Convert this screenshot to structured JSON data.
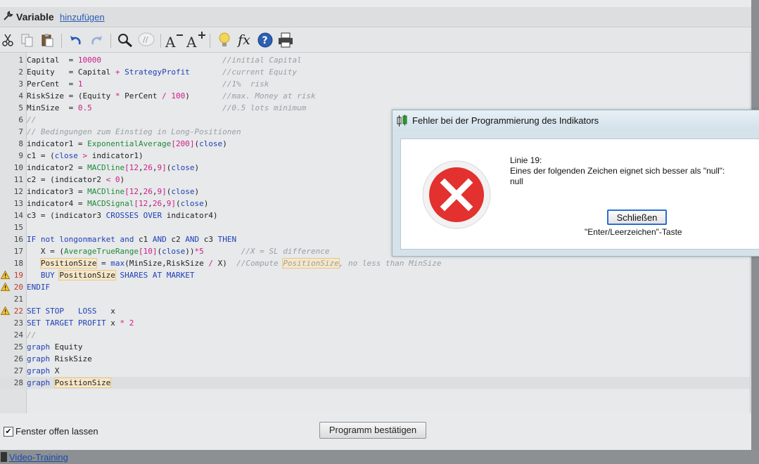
{
  "window": {
    "title": "Variable",
    "add_link": "hinzufügen"
  },
  "toolbar": {
    "icons": [
      "cut-icon",
      "copy-icon",
      "paste-icon",
      "undo-icon",
      "redo-icon",
      "search-icon",
      "comment-icon",
      "font-decrease-icon",
      "font-increase-icon",
      "lightbulb-icon",
      "function-icon",
      "help-icon",
      "print-icon"
    ]
  },
  "editor": {
    "lines": [
      {
        "n": "1",
        "warn": false
      },
      {
        "n": "2",
        "warn": false
      },
      {
        "n": "3",
        "warn": false
      },
      {
        "n": "4",
        "warn": false
      },
      {
        "n": "5",
        "warn": false
      },
      {
        "n": "6",
        "warn": false
      },
      {
        "n": "7",
        "warn": false
      },
      {
        "n": "8",
        "warn": false
      },
      {
        "n": "9",
        "warn": false
      },
      {
        "n": "10",
        "warn": false
      },
      {
        "n": "11",
        "warn": false
      },
      {
        "n": "12",
        "warn": false
      },
      {
        "n": "13",
        "warn": false
      },
      {
        "n": "14",
        "warn": false
      },
      {
        "n": "15",
        "warn": false
      },
      {
        "n": "16",
        "warn": false
      },
      {
        "n": "17",
        "warn": false
      },
      {
        "n": "18",
        "warn": false
      },
      {
        "n": "19",
        "warn": true
      },
      {
        "n": "20",
        "warn": true
      },
      {
        "n": "21",
        "warn": false
      },
      {
        "n": "22",
        "warn": true
      },
      {
        "n": "23",
        "warn": false
      },
      {
        "n": "24",
        "warn": false
      },
      {
        "n": "25",
        "warn": false
      },
      {
        "n": "26",
        "warn": false
      },
      {
        "n": "27",
        "warn": false
      },
      {
        "n": "28",
        "warn": false
      }
    ],
    "code": [
      "Capital  = 10000                          //initial Capital",
      "Equity   = Capital + StrategyProfit       //current Equity",
      "PerCent  = 1                              //1%  risk",
      "RiskSize = (Equity * PerCent / 100)       //max. Money at risk",
      "MinSize  = 0.5                            //0.5 lots minimum",
      "//",
      "// Bedingungen zum Einstieg in Long-Positionen",
      "indicator1 = ExponentialAverage[200](close)",
      "c1 = (close > indicator1)",
      "indicator2 = MACDline[12,26,9](close)",
      "c2 = (indicator2 < 0)",
      "indicator3 = MACDline[12,26,9](close)",
      "indicator4 = MACDSignal[12,26,9](close)",
      "c3 = (indicator3 CROSSES OVER indicator4)",
      "",
      "IF not longonmarket and c1 AND c2 AND c3 THEN",
      "   X = (AverageTrueRange[10](close))*5        //X = SL difference",
      "   PositionSize = max(MinSize,RiskSize / X)  //Compute PositionSize, no less than MinSize",
      "   BUY PositionSize SHARES AT MARKET",
      "ENDIF",
      "",
      "SET STOP   LOSS   x",
      "SET TARGET PROFIT x * 2",
      "//",
      "graph Equity",
      "graph RiskSize",
      "graph X",
      "graph PositionSize"
    ]
  },
  "bottom": {
    "keep_open_label": "Fenster offen lassen",
    "keep_open_checked": true,
    "confirm_label": "Programm bestätigen"
  },
  "status": {
    "video_link": "Video-Training"
  },
  "dialog": {
    "title": "Fehler bei der Programmierung des Indikators",
    "line1": "Linie 19:",
    "line2": "Eines der folgenden Zeichen eignet sich besser als \"null\":",
    "line3": "null",
    "close_label": "Schließen",
    "hint": "\"Enter/Leerzeichen\"-Taste"
  },
  "colors": {
    "keyword": "#1f3fb8",
    "number": "#d01c8b",
    "comment": "#9aa0a4",
    "function": "#1f8a3a",
    "error_red": "#e2312f"
  }
}
